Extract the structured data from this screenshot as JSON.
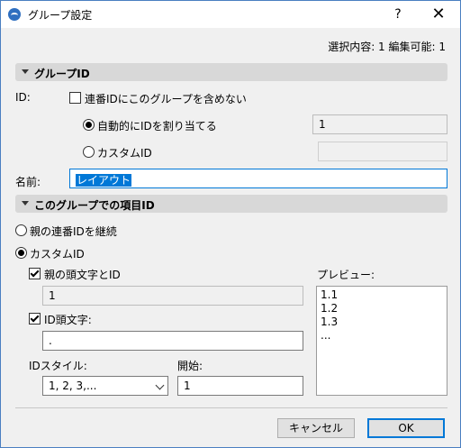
{
  "window": {
    "title": "グループ設定",
    "help": "?",
    "close": "✕"
  },
  "summary": "選択内容: 1 編集可能: 1",
  "group_id_section": {
    "header": "グループID",
    "id_label": "ID:",
    "exclude_checkbox": {
      "label": "連番IDにこのグループを含めない",
      "checked": false
    },
    "auto_assign": {
      "label": "自動的にIDを割り当てる",
      "selected": true,
      "value": "1"
    },
    "custom": {
      "label": "カスタムID",
      "selected": false,
      "value": ""
    },
    "name_label": "名前:",
    "name_value": "レイアウト"
  },
  "item_id_section": {
    "header": "このグループでの項目ID",
    "inherit": {
      "label": "親の連番IDを継続",
      "selected": false
    },
    "custom": {
      "label": "カスタムID",
      "selected": true
    },
    "parent_prefix": {
      "label": "親の頭文字とID",
      "checked": true,
      "value": "1"
    },
    "id_prefix": {
      "label": "ID頭文字:",
      "checked": true,
      "value": "."
    },
    "id_style": {
      "label": "IDスタイル:",
      "value": "1, 2, 3,..."
    },
    "start": {
      "label": "開始:",
      "value": "1"
    },
    "preview": {
      "label": "プレビュー:",
      "lines": [
        "1.1",
        "1.2",
        "1.3",
        "..."
      ]
    }
  },
  "buttons": {
    "cancel": "キャンセル",
    "ok": "OK"
  },
  "colors": {
    "accent": "#0078d7",
    "section_bg": "#d8d8d8",
    "dialog_bg": "#f0f0f0"
  }
}
